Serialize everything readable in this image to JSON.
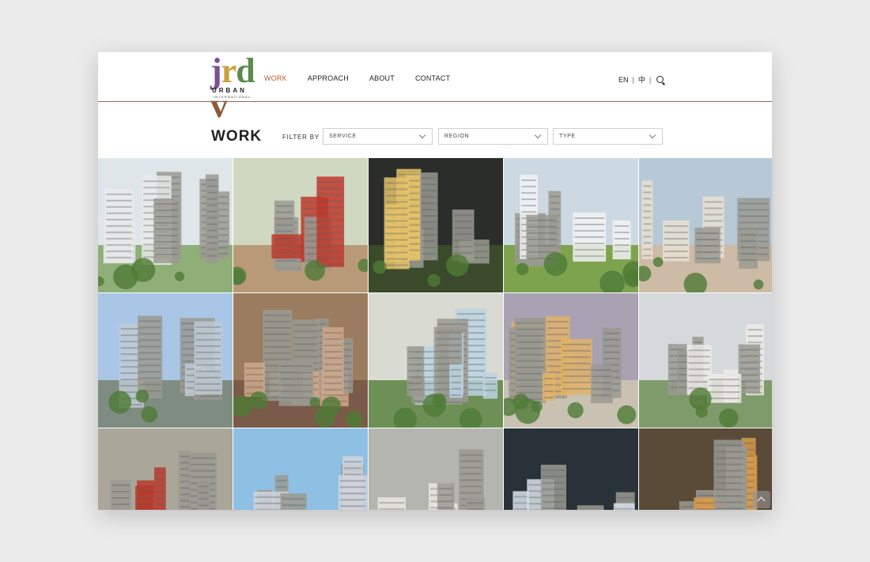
{
  "brand": {
    "mark_letters": [
      "j",
      "r",
      "d",
      "v"
    ],
    "mark_colors": [
      "#7e4f91",
      "#c9a23c",
      "#5b8c4a",
      "#8c5a3a"
    ],
    "line1": "URBAN",
    "line2": "INTERNATIONAL"
  },
  "nav": {
    "items": [
      {
        "label": "WORK",
        "active": true
      },
      {
        "label": "APPROACH",
        "active": false
      },
      {
        "label": "ABOUT",
        "active": false
      },
      {
        "label": "CONTACT",
        "active": false
      }
    ]
  },
  "util": {
    "lang_en": "EN",
    "sep": "|",
    "lang_zh": "中",
    "search_icon": "search-icon"
  },
  "page": {
    "title": "WORK",
    "filter_label": "FILTER BY"
  },
  "filters": [
    {
      "label": "SERVICE"
    },
    {
      "label": "REGION"
    },
    {
      "label": "TYPE"
    }
  ],
  "colors": {
    "accent": "#b35a2f",
    "header_rule": "#8a6a5c"
  },
  "projects": [
    {
      "scene": "aerial-city",
      "sky": "#dfe6ea",
      "base": "#8fae78",
      "accent": "#e9e9ea"
    },
    {
      "scene": "arcade-street",
      "sky": "#cfd8c0",
      "base": "#b99a78",
      "accent": "#c0392b"
    },
    {
      "scene": "night-plaza",
      "sky": "#2a2d2a",
      "base": "#3a4a2a",
      "accent": "#e6c36a"
    },
    {
      "scene": "towers-park",
      "sky": "#cdd9e2",
      "base": "#7ea34f",
      "accent": "#f2f2f2"
    },
    {
      "scene": "classical-facade",
      "sky": "#b7c8d6",
      "base": "#cdbba5",
      "accent": "#e8e0d2"
    },
    {
      "scene": "office-tower",
      "sky": "#a9c6e6",
      "base": "#7f8c82",
      "accent": "#bfcad4"
    },
    {
      "scene": "covered-street",
      "sky": "#9c7c5e",
      "base": "#7a5a48",
      "accent": "#cfa989"
    },
    {
      "scene": "waterfront",
      "sky": "#d9dad2",
      "base": "#6e8f56",
      "accent": "#bcd3e0"
    },
    {
      "scene": "lit-villa",
      "sky": "#a9a2b3",
      "base": "#c9c2b2",
      "accent": "#e1b36a"
    },
    {
      "scene": "residential-aerial",
      "sky": "#d6d9dc",
      "base": "#7f9a6b",
      "accent": "#eceae6"
    },
    {
      "scene": "retail-aerial",
      "sky": "#aaa79a",
      "base": "#8a7d6e",
      "accent": "#b83a2a"
    },
    {
      "scene": "facade-trees",
      "sky": "#8ec0e4",
      "base": "#4c7a3e",
      "accent": "#d1d4da"
    },
    {
      "scene": "interior-rendering",
      "sky": "#b5b5b0",
      "base": "#8a8a86",
      "accent": "#e9e7e1"
    },
    {
      "scene": "night-resort",
      "sky": "#283238",
      "base": "#34505a",
      "accent": "#d9e4ea"
    },
    {
      "scene": "courtyard-market",
      "sky": "#5a4a38",
      "base": "#4f6d3a",
      "accent": "#d99a4a"
    }
  ]
}
